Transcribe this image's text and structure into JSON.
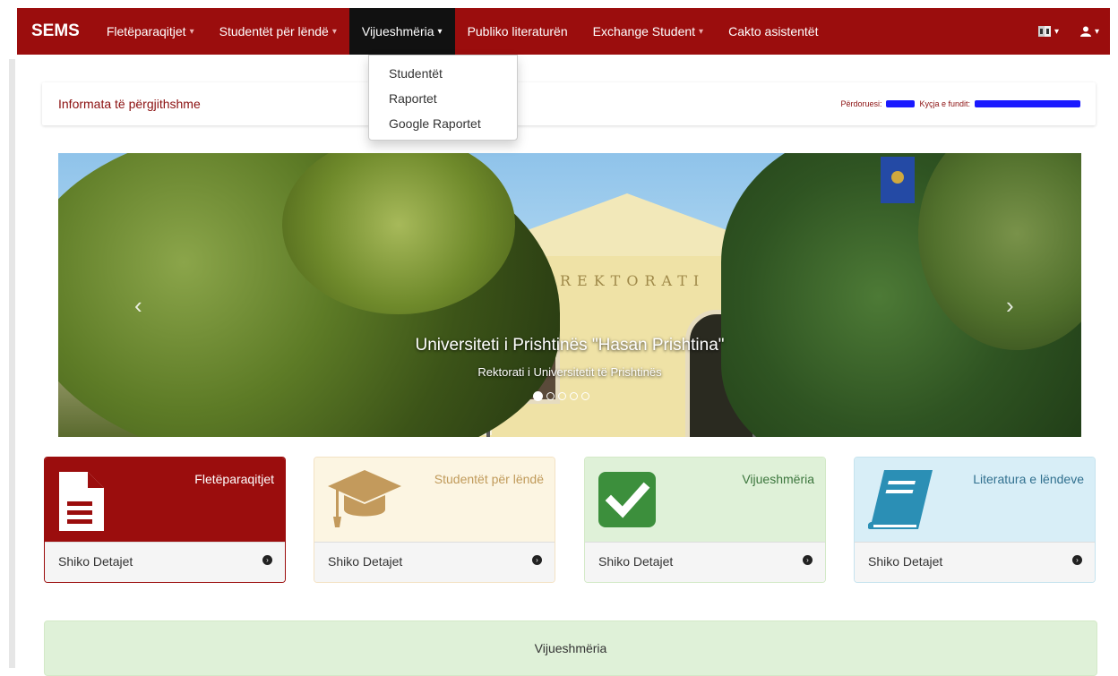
{
  "navbar": {
    "brand": "SEMS",
    "items": [
      {
        "label": "Fletëparaqitjet",
        "dropdown": true,
        "active": false
      },
      {
        "label": "Studentët për lëndë",
        "dropdown": true,
        "active": false
      },
      {
        "label": "Vijueshmëria",
        "dropdown": true,
        "active": true
      },
      {
        "label": "Publiko literaturën",
        "dropdown": false,
        "active": false
      },
      {
        "label": "Exchange Student",
        "dropdown": true,
        "active": false
      },
      {
        "label": "Cakto asistentët",
        "dropdown": false,
        "active": false
      }
    ],
    "right_icons": [
      "language-flag-icon",
      "user-icon"
    ]
  },
  "dropdown_menu": {
    "items": [
      "Studentët",
      "Raportet",
      "Google Raportet"
    ]
  },
  "info_bar": {
    "title": "Informata të përgjithshme",
    "user_label": "Përdoruesi:",
    "last_login_label": "Kyçja e fundit:"
  },
  "carousel": {
    "caption_title": "Universiteti i Prishtinës \"Hasan Prishtina\"",
    "caption_subtitle": "Rektorati i Universitetit të Prishtinës",
    "building_sign": "REKTORATI",
    "slide_count": 5,
    "active_slide": 1
  },
  "panels": [
    {
      "title": "Fletëparaqitjet",
      "footer": "Shiko Detajet",
      "icon": "document-icon",
      "color": "#9b0d0d"
    },
    {
      "title": "Studentët për lëndë",
      "footer": "Shiko Detajet",
      "icon": "graduation-cap-icon",
      "color": "#fcf5e2"
    },
    {
      "title": "Vijueshmëria",
      "footer": "Shiko Detajet",
      "icon": "checkmark-icon",
      "color": "#dff1d8"
    },
    {
      "title": "Literatura e lëndeve",
      "footer": "Shiko Detajet",
      "icon": "book-icon",
      "color": "#d8eef7"
    }
  ],
  "bottom_panel": {
    "title": "Vijueshmëria"
  }
}
